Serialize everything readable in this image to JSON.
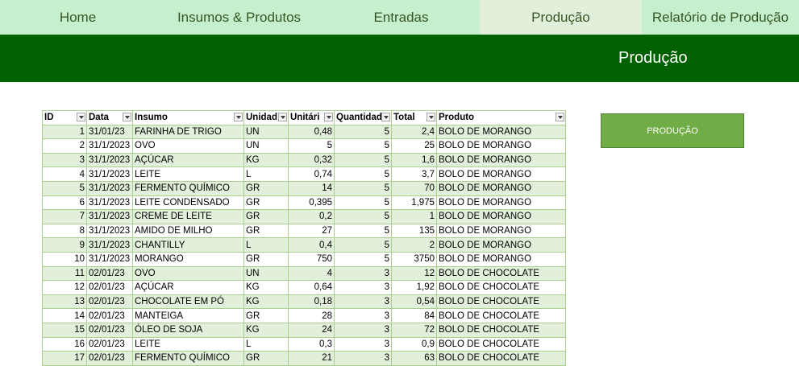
{
  "nav": {
    "tabs": [
      {
        "label": "Home"
      },
      {
        "label": "Insumos & Produtos"
      },
      {
        "label": "Entradas"
      },
      {
        "label": "Produção"
      },
      {
        "label": "Relatório de Produção"
      }
    ],
    "active_index": 3
  },
  "banner": {
    "title": "Produção"
  },
  "button": {
    "label": "PRODUÇÃO"
  },
  "table": {
    "headers": [
      "ID",
      "Data",
      "Insumo",
      "Unidad",
      "Unitári",
      "Quantidad",
      "Total",
      "Produto"
    ],
    "rows": [
      [
        "1",
        "31/01/23",
        "FARINHA DE TRIGO",
        "UN",
        "0,48",
        "5",
        "2,4",
        "BOLO DE MORANGO"
      ],
      [
        "2",
        "31/1/2023",
        "OVO",
        "UN",
        "5",
        "5",
        "25",
        "BOLO DE MORANGO"
      ],
      [
        "3",
        "31/1/2023",
        "AÇÚCAR",
        "KG",
        "0,32",
        "5",
        "1,6",
        "BOLO DE MORANGO"
      ],
      [
        "4",
        "31/1/2023",
        "LEITE",
        "L",
        "0,74",
        "5",
        "3,7",
        "BOLO DE MORANGO"
      ],
      [
        "5",
        "31/1/2023",
        "FERMENTO QUÍMICO",
        "GR",
        "14",
        "5",
        "70",
        "BOLO DE MORANGO"
      ],
      [
        "6",
        "31/1/2023",
        "LEITE CONDENSADO",
        "GR",
        "0,395",
        "5",
        "1,975",
        "BOLO DE MORANGO"
      ],
      [
        "7",
        "31/1/2023",
        "CREME DE LEITE",
        "GR",
        "0,2",
        "5",
        "1",
        "BOLO DE MORANGO"
      ],
      [
        "8",
        "31/1/2023",
        "AMIDO DE MILHO",
        "GR",
        "27",
        "5",
        "135",
        "BOLO DE MORANGO"
      ],
      [
        "9",
        "31/1/2023",
        "CHANTILLY",
        "L",
        "0,4",
        "5",
        "2",
        "BOLO DE MORANGO"
      ],
      [
        "10",
        "31/1/2023",
        "MORANGO",
        "GR",
        "750",
        "5",
        "3750",
        "BOLO DE MORANGO"
      ],
      [
        "11",
        "02/01/23",
        "OVO",
        "UN",
        "4",
        "3",
        "12",
        "BOLO DE CHOCOLATE"
      ],
      [
        "12",
        "02/01/23",
        "AÇÚCAR",
        "KG",
        "0,64",
        "3",
        "1,92",
        "BOLO DE CHOCOLATE"
      ],
      [
        "13",
        "02/01/23",
        "CHOCOLATE EM PÓ",
        "KG",
        "0,18",
        "3",
        "0,54",
        "BOLO DE CHOCOLATE"
      ],
      [
        "14",
        "02/01/23",
        "MANTEIGA",
        "GR",
        "28",
        "3",
        "84",
        "BOLO DE CHOCOLATE"
      ],
      [
        "15",
        "02/01/23",
        "ÓLEO DE SOJA",
        "KG",
        "24",
        "3",
        "72",
        "BOLO DE CHOCOLATE"
      ],
      [
        "16",
        "02/01/23",
        "LEITE",
        "L",
        "0,3",
        "3",
        "0,9",
        "BOLO DE CHOCOLATE"
      ],
      [
        "17",
        "02/01/23",
        "FERMENTO QUÍMICO",
        "GR",
        "21",
        "3",
        "63",
        "BOLO DE CHOCOLATE"
      ]
    ]
  }
}
